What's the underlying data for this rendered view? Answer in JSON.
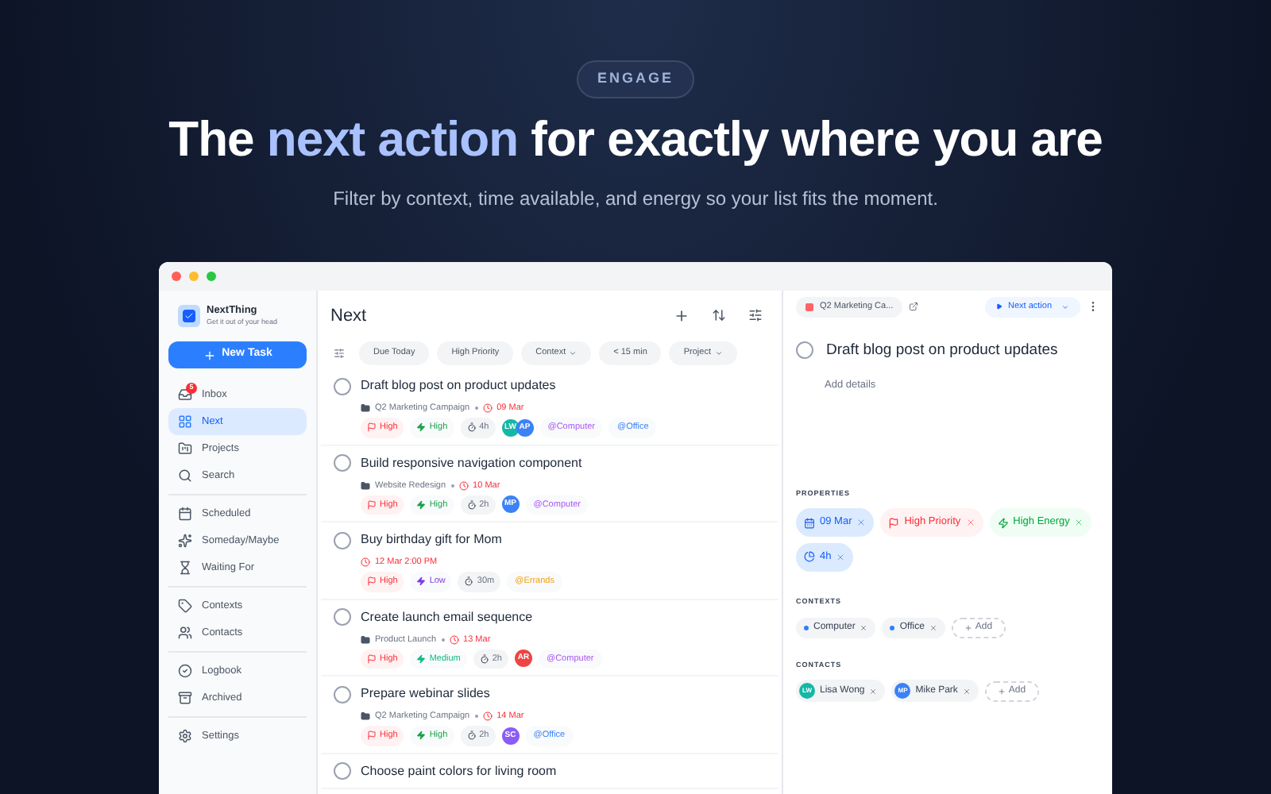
{
  "hero": {
    "badge": "ENGAGE",
    "headline": {
      "before": "The",
      "highlight": "next action",
      "after": "for exactly where you are"
    },
    "subtitle": "Filter by context, time available, and energy so your list fits the moment."
  },
  "sidebar": {
    "app_name": "NextThing",
    "tagline": "Get it out of your head",
    "new_task": "New Task",
    "sections": [
      [
        {
          "label": "Inbox",
          "kind": "inbox",
          "badge": "5",
          "selected": false
        },
        {
          "label": "Next",
          "kind": "grid",
          "selected": true
        },
        {
          "label": "Projects",
          "kind": "projects",
          "selected": false
        },
        {
          "label": "Search",
          "kind": "search",
          "selected": false
        }
      ],
      [
        {
          "label": "Scheduled",
          "kind": "calendar",
          "selected": false
        },
        {
          "label": "Someday/Maybe",
          "kind": "sparkles",
          "selected": false
        },
        {
          "label": "Waiting For",
          "kind": "hourglass",
          "selected": false
        }
      ],
      [
        {
          "label": "Contexts",
          "kind": "tag",
          "selected": false
        },
        {
          "label": "Contacts",
          "kind": "users",
          "selected": false
        }
      ],
      [
        {
          "label": "Logbook",
          "kind": "check",
          "selected": false
        },
        {
          "label": "Archived",
          "kind": "archive",
          "selected": false
        }
      ],
      [
        {
          "label": "Settings",
          "kind": "settings",
          "selected": false
        }
      ]
    ]
  },
  "list": {
    "title": "Next",
    "filters": [
      {
        "label": "Due Today",
        "dropdown": false
      },
      {
        "label": "High Priority",
        "dropdown": false
      },
      {
        "label": "Context",
        "dropdown": true
      },
      {
        "label": "< 15 min",
        "dropdown": false
      },
      {
        "label": "Project",
        "dropdown": true
      }
    ],
    "tasks": [
      {
        "title": "Draft blog post on product updates",
        "checked": false,
        "project": "Q2 Marketing Campaign",
        "due": "09 Mar",
        "priority": "High",
        "energy": {
          "label": "High",
          "color": "#16a34a"
        },
        "duration": "4h",
        "avatars": [
          {
            "initials": "LW",
            "color": "#14b8a6"
          },
          {
            "initials": "AP",
            "color": "#3b82f6"
          }
        ],
        "contexts": [
          {
            "label": "@Computer",
            "color": "#a855f7"
          },
          {
            "label": "@Office",
            "color": "#3b82f6"
          }
        ]
      },
      {
        "title": "Build responsive navigation component",
        "checked": false,
        "project": "Website Redesign",
        "due": "10 Mar",
        "priority": "High",
        "energy": {
          "label": "High",
          "color": "#16a34a"
        },
        "duration": "2h",
        "avatars": [
          {
            "initials": "MP",
            "color": "#3b82f6"
          }
        ],
        "contexts": [
          {
            "label": "@Computer",
            "color": "#a855f7"
          }
        ]
      },
      {
        "title": "Buy birthday gift for Mom",
        "checked": false,
        "due": "12 Mar 2:00 PM",
        "priority": "High",
        "energy": {
          "label": "Low",
          "color": "#7c3aed"
        },
        "duration": "30m",
        "contexts": [
          {
            "label": "@Errands",
            "color": "#f59e0b"
          }
        ]
      },
      {
        "title": "Create launch email sequence",
        "checked": false,
        "project": "Product Launch",
        "due": "13 Mar",
        "priority": "High",
        "energy": {
          "label": "Medium",
          "color": "#10b981"
        },
        "duration": "2h",
        "avatars": [
          {
            "initials": "AR",
            "color": "#ef4444"
          }
        ],
        "contexts": [
          {
            "label": "@Computer",
            "color": "#a855f7"
          }
        ]
      },
      {
        "title": "Prepare webinar slides",
        "checked": false,
        "project": "Q2 Marketing Campaign",
        "due": "14 Mar",
        "priority": "High",
        "energy": {
          "label": "High",
          "color": "#16a34a"
        },
        "duration": "2h",
        "avatars": [
          {
            "initials": "SC",
            "color": "#8b5cf6"
          }
        ],
        "contexts": [
          {
            "label": "@Office",
            "color": "#3b82f6"
          }
        ]
      },
      {
        "title": "Choose paint colors for living room",
        "checked": false
      }
    ]
  },
  "detail": {
    "project": "Q2 Marketing Ca...",
    "status": "Next action",
    "title": "Draft blog post on product updates",
    "checked": false,
    "details_placeholder": "Add details",
    "properties_label": "PROPERTIES",
    "properties": [
      {
        "label": "09 Mar",
        "kind": "date"
      },
      {
        "label": "High Priority",
        "kind": "priority"
      },
      {
        "label": "High Energy",
        "kind": "energy"
      },
      {
        "label": "4h",
        "kind": "duration"
      }
    ],
    "contexts_label": "CONTEXTS",
    "contexts": [
      {
        "label": "Computer"
      },
      {
        "label": "Office"
      }
    ],
    "contexts_add": "Add",
    "contacts_label": "CONTACTS",
    "contacts": [
      {
        "initials": "LW",
        "name": "Lisa Wong",
        "color": "#14b8a6"
      },
      {
        "initials": "MP",
        "name": "Mike Park",
        "color": "#3b82f6"
      }
    ],
    "contacts_add": "Add"
  }
}
